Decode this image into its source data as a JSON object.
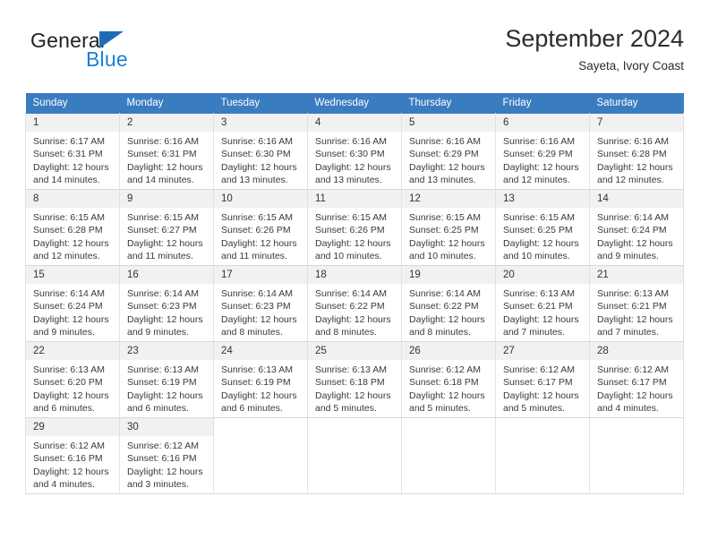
{
  "logo": {
    "word_one": "General",
    "word_two": "Blue",
    "triangle_color": "#1e6bb8",
    "blue_color": "#1c7fd4"
  },
  "header": {
    "title": "September 2024",
    "subtitle": "Sayeta, Ivory Coast"
  },
  "theme": {
    "header_bg": "#3a7cc0",
    "header_text": "#ffffff",
    "daynum_bg": "#f1f1f1",
    "cell_bg": "#ffffff",
    "grid_line": "#e2e2e2"
  },
  "weekday_headers": [
    "Sunday",
    "Monday",
    "Tuesday",
    "Wednesday",
    "Thursday",
    "Friday",
    "Saturday"
  ],
  "labels": {
    "sunrise_prefix": "Sunrise:",
    "sunset_prefix": "Sunset:",
    "daylight_prefix": "Daylight:"
  },
  "weeks": [
    [
      {
        "day": "1",
        "line1": "Sunrise: 6:17 AM",
        "line2": "Sunset: 6:31 PM",
        "line3": "Daylight: 12 hours",
        "line4": "and 14 minutes."
      },
      {
        "day": "2",
        "line1": "Sunrise: 6:16 AM",
        "line2": "Sunset: 6:31 PM",
        "line3": "Daylight: 12 hours",
        "line4": "and 14 minutes."
      },
      {
        "day": "3",
        "line1": "Sunrise: 6:16 AM",
        "line2": "Sunset: 6:30 PM",
        "line3": "Daylight: 12 hours",
        "line4": "and 13 minutes."
      },
      {
        "day": "4",
        "line1": "Sunrise: 6:16 AM",
        "line2": "Sunset: 6:30 PM",
        "line3": "Daylight: 12 hours",
        "line4": "and 13 minutes."
      },
      {
        "day": "5",
        "line1": "Sunrise: 6:16 AM",
        "line2": "Sunset: 6:29 PM",
        "line3": "Daylight: 12 hours",
        "line4": "and 13 minutes."
      },
      {
        "day": "6",
        "line1": "Sunrise: 6:16 AM",
        "line2": "Sunset: 6:29 PM",
        "line3": "Daylight: 12 hours",
        "line4": "and 12 minutes."
      },
      {
        "day": "7",
        "line1": "Sunrise: 6:16 AM",
        "line2": "Sunset: 6:28 PM",
        "line3": "Daylight: 12 hours",
        "line4": "and 12 minutes."
      }
    ],
    [
      {
        "day": "8",
        "line1": "Sunrise: 6:15 AM",
        "line2": "Sunset: 6:28 PM",
        "line3": "Daylight: 12 hours",
        "line4": "and 12 minutes."
      },
      {
        "day": "9",
        "line1": "Sunrise: 6:15 AM",
        "line2": "Sunset: 6:27 PM",
        "line3": "Daylight: 12 hours",
        "line4": "and 11 minutes."
      },
      {
        "day": "10",
        "line1": "Sunrise: 6:15 AM",
        "line2": "Sunset: 6:26 PM",
        "line3": "Daylight: 12 hours",
        "line4": "and 11 minutes."
      },
      {
        "day": "11",
        "line1": "Sunrise: 6:15 AM",
        "line2": "Sunset: 6:26 PM",
        "line3": "Daylight: 12 hours",
        "line4": "and 10 minutes."
      },
      {
        "day": "12",
        "line1": "Sunrise: 6:15 AM",
        "line2": "Sunset: 6:25 PM",
        "line3": "Daylight: 12 hours",
        "line4": "and 10 minutes."
      },
      {
        "day": "13",
        "line1": "Sunrise: 6:15 AM",
        "line2": "Sunset: 6:25 PM",
        "line3": "Daylight: 12 hours",
        "line4": "and 10 minutes."
      },
      {
        "day": "14",
        "line1": "Sunrise: 6:14 AM",
        "line2": "Sunset: 6:24 PM",
        "line3": "Daylight: 12 hours",
        "line4": "and 9 minutes."
      }
    ],
    [
      {
        "day": "15",
        "line1": "Sunrise: 6:14 AM",
        "line2": "Sunset: 6:24 PM",
        "line3": "Daylight: 12 hours",
        "line4": "and 9 minutes."
      },
      {
        "day": "16",
        "line1": "Sunrise: 6:14 AM",
        "line2": "Sunset: 6:23 PM",
        "line3": "Daylight: 12 hours",
        "line4": "and 9 minutes."
      },
      {
        "day": "17",
        "line1": "Sunrise: 6:14 AM",
        "line2": "Sunset: 6:23 PM",
        "line3": "Daylight: 12 hours",
        "line4": "and 8 minutes."
      },
      {
        "day": "18",
        "line1": "Sunrise: 6:14 AM",
        "line2": "Sunset: 6:22 PM",
        "line3": "Daylight: 12 hours",
        "line4": "and 8 minutes."
      },
      {
        "day": "19",
        "line1": "Sunrise: 6:14 AM",
        "line2": "Sunset: 6:22 PM",
        "line3": "Daylight: 12 hours",
        "line4": "and 8 minutes."
      },
      {
        "day": "20",
        "line1": "Sunrise: 6:13 AM",
        "line2": "Sunset: 6:21 PM",
        "line3": "Daylight: 12 hours",
        "line4": "and 7 minutes."
      },
      {
        "day": "21",
        "line1": "Sunrise: 6:13 AM",
        "line2": "Sunset: 6:21 PM",
        "line3": "Daylight: 12 hours",
        "line4": "and 7 minutes."
      }
    ],
    [
      {
        "day": "22",
        "line1": "Sunrise: 6:13 AM",
        "line2": "Sunset: 6:20 PM",
        "line3": "Daylight: 12 hours",
        "line4": "and 6 minutes."
      },
      {
        "day": "23",
        "line1": "Sunrise: 6:13 AM",
        "line2": "Sunset: 6:19 PM",
        "line3": "Daylight: 12 hours",
        "line4": "and 6 minutes."
      },
      {
        "day": "24",
        "line1": "Sunrise: 6:13 AM",
        "line2": "Sunset: 6:19 PM",
        "line3": "Daylight: 12 hours",
        "line4": "and 6 minutes."
      },
      {
        "day": "25",
        "line1": "Sunrise: 6:13 AM",
        "line2": "Sunset: 6:18 PM",
        "line3": "Daylight: 12 hours",
        "line4": "and 5 minutes."
      },
      {
        "day": "26",
        "line1": "Sunrise: 6:12 AM",
        "line2": "Sunset: 6:18 PM",
        "line3": "Daylight: 12 hours",
        "line4": "and 5 minutes."
      },
      {
        "day": "27",
        "line1": "Sunrise: 6:12 AM",
        "line2": "Sunset: 6:17 PM",
        "line3": "Daylight: 12 hours",
        "line4": "and 5 minutes."
      },
      {
        "day": "28",
        "line1": "Sunrise: 6:12 AM",
        "line2": "Sunset: 6:17 PM",
        "line3": "Daylight: 12 hours",
        "line4": "and 4 minutes."
      }
    ],
    [
      {
        "day": "29",
        "line1": "Sunrise: 6:12 AM",
        "line2": "Sunset: 6:16 PM",
        "line3": "Daylight: 12 hours",
        "line4": "and 4 minutes."
      },
      {
        "day": "30",
        "line1": "Sunrise: 6:12 AM",
        "line2": "Sunset: 6:16 PM",
        "line3": "Daylight: 12 hours",
        "line4": "and 3 minutes."
      },
      {
        "day": "",
        "line1": "",
        "line2": "",
        "line3": "",
        "line4": ""
      },
      {
        "day": "",
        "line1": "",
        "line2": "",
        "line3": "",
        "line4": ""
      },
      {
        "day": "",
        "line1": "",
        "line2": "",
        "line3": "",
        "line4": ""
      },
      {
        "day": "",
        "line1": "",
        "line2": "",
        "line3": "",
        "line4": ""
      },
      {
        "day": "",
        "line1": "",
        "line2": "",
        "line3": "",
        "line4": ""
      }
    ]
  ]
}
